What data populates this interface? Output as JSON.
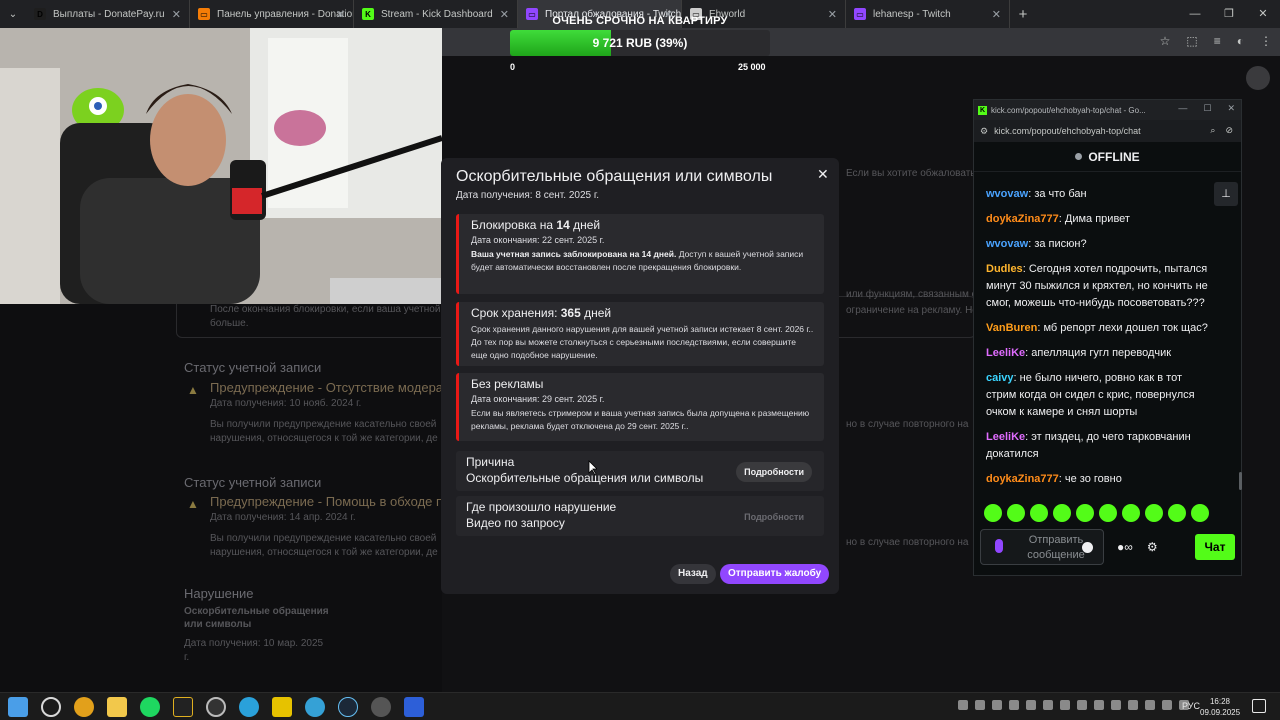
{
  "browser": {
    "tabs": [
      {
        "label": "Выплаты - DonatePay.ru",
        "favicon": "D",
        "color": "#1e1e1e"
      },
      {
        "label": "Панель управления - Donation",
        "favicon": "▭",
        "color": "#f57d07"
      },
      {
        "label": "Stream - Kick Dashboard",
        "favicon": "K",
        "color": "#53fc18"
      },
      {
        "label": "Портал обжалования - Twitch",
        "favicon": "▭",
        "color": "#9147ff"
      },
      {
        "label": "Ehworld",
        "favicon": "▭",
        "color": "#cccccc"
      },
      {
        "label": "lehanesp - Twitch",
        "favicon": "▭",
        "color": "#9147ff"
      }
    ],
    "new_tab": "+"
  },
  "goal": {
    "title": "ОЧЕНЬ СРОЧНО НА КВАРТИРУ",
    "amount_text": "9 721 RUB (39%)",
    "progress": 0.39,
    "min": "0",
    "max": "25 000",
    "fill_color": "#33c72d"
  },
  "background": {
    "section1_title": "Статус учетной записи",
    "section1_item": "Предупреждение - Отсутствие модера",
    "section1_date": "Дата получения: 10 нояб. 2024 г.",
    "section1_text1": "Вы получили предупреждение касательно своей",
    "section1_text2": "нарушения, относящегося к той же категории, де",
    "section2_title": "Статус учетной записи",
    "section2_item": "Предупреждение - Помощь в обходе пр",
    "section2_date": "Дата получения: 14 апр. 2024 г.",
    "section2_text1": "Вы получили предупреждение касательно своей",
    "section2_text2": "нарушения, относящегося к той же категории, де",
    "section3_title": "Нарушение",
    "section3_sub1": "Оскорбительные обращения",
    "section3_sub2": "или символы",
    "section3_date1": "Дата получения: 10 мар. 2025",
    "section3_date2": "г.",
    "top_text": "Если вы хотите обжаловать уве",
    "box_text1": "После окончания блокировки, если ваша учетной",
    "box_text2": "больше.",
    "right_text1": "или функциям, связанным с",
    "right_text2": "ограничение на рекламу. Не",
    "right_text3": "но в случае повторного на",
    "right_text4": "но в случае повторного на"
  },
  "modal": {
    "title": "Оскорбительные обращения или символы",
    "date": "Дата получения: 8 сент. 2025 г.",
    "cards": [
      {
        "title_prefix": "Блокировка на ",
        "title_bold": "14",
        "title_suffix": " дней",
        "date": "Дата окончания: 22 сент. 2025 г.",
        "body_bold": "Ваша учетная запись заблокирована на 14 дней.",
        "body": " Доступ к вашей учетной записи будет автоматически восстановлен после прекращения блокировки."
      },
      {
        "title_prefix": "Срок хранения: ",
        "title_bold": "365",
        "title_suffix": " дней",
        "date": "",
        "body_bold": "",
        "body": "Срок хранения данного нарушения для вашей учетной записи истекает 8 сент. 2026 г.. До тех пор вы можете столкнуться с серьезными последствиями, если совершите еще одно подобное нарушение."
      },
      {
        "title_prefix": "Без рекламы",
        "title_bold": "",
        "title_suffix": "",
        "date": "Дата окончания: 29 сент. 2025 г.",
        "body_bold": "",
        "body": "Если вы являетесь стримером и ваша учетная запись была допущена к размещению рекламы, реклама будет отключена до 29 сент. 2025 г.."
      }
    ],
    "reason_title": "Причина",
    "reason_value": "Оскорбительные обращения или символы",
    "where_title": "Где произошло нарушение",
    "where_value": "Видео по запросу",
    "details_label": "Подробности",
    "back_label": "Назад",
    "send_label": "Отправить жалобу"
  },
  "kick": {
    "window_title": "kick.com/popout/ehchobyah-top/chat - Go...",
    "url": "kick.com/popout/ehchobyah-top/chat",
    "status": "OFFLINE",
    "messages": [
      {
        "user": "wvovaw",
        "color": "#4aa3ff",
        "text": "за что бан"
      },
      {
        "user": "doykaZina777",
        "color": "#ff8c1a",
        "text": "Дима привет"
      },
      {
        "user": "wvovaw",
        "color": "#4aa3ff",
        "text": "за писюн?"
      },
      {
        "user": "Dudles",
        "color": "#ffb52e",
        "text": "Сегодня хотел подрочить, пытался минут 30 пыжился и кряхтел, но кончить не смог, можешь что-нибудь посоветовать???"
      },
      {
        "user": "VanBuren",
        "color": "#ff9d1a",
        "text": "мб репорт лехи дошел ток щас?"
      },
      {
        "user": "LeeliKe",
        "color": "#e06cff",
        "text": "апелляция гугл переводчик"
      },
      {
        "user": "caivy",
        "color": "#3ad4ff",
        "text": "не было ничего, ровно как в тот стрим когда он сидел с крис, повернулся очком к камере и снял шорты"
      },
      {
        "user": "LeeliKe",
        "color": "#e06cff",
        "text": "эт пиздец, до чего тарковчанин докатился"
      },
      {
        "user": "doykaZina777",
        "color": "#ff8c1a",
        "text": "че зо говно"
      }
    ],
    "input_placeholder": "Отправить сообщение",
    "chat_button": "Чат",
    "accent": "#53fc18"
  },
  "taskbar": {
    "lang": "РУС",
    "time": "16:28",
    "date": "09.09.2025"
  }
}
